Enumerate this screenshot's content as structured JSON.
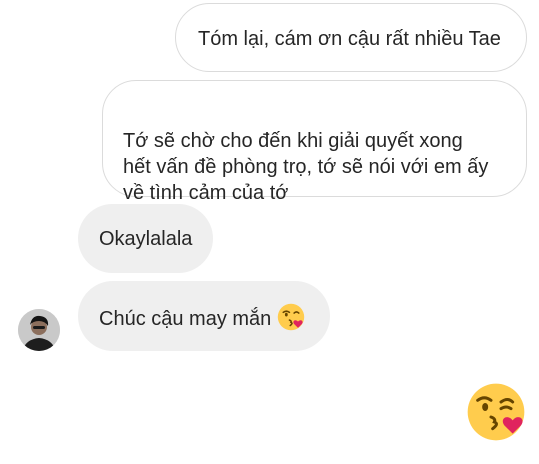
{
  "messages": [
    {
      "side": "sent",
      "text": "Tóm lại, cám ơn cậu rất nhiều Tae"
    },
    {
      "side": "sent",
      "text": "Tớ sẽ chờ cho đến khi giải quyết xong\nhết vấn đề phòng trọ, tớ sẽ nói với em ấy\nvề tình cảm của tớ"
    },
    {
      "side": "received",
      "text": "Okaylalala"
    },
    {
      "side": "received",
      "text": "Chúc cậu may mắn",
      "emoji": "face-blowing-a-kiss-icon"
    }
  ],
  "sent_emoji": "face-blowing-a-kiss-icon",
  "avatar": "contact-avatar-photo",
  "colors": {
    "received_bubble": "#efefef",
    "sent_bubble_border": "#dbdbdb",
    "text": "#262626",
    "emoji_yellow": "#ffcc4d",
    "kiss_heart": "#e0245e"
  }
}
